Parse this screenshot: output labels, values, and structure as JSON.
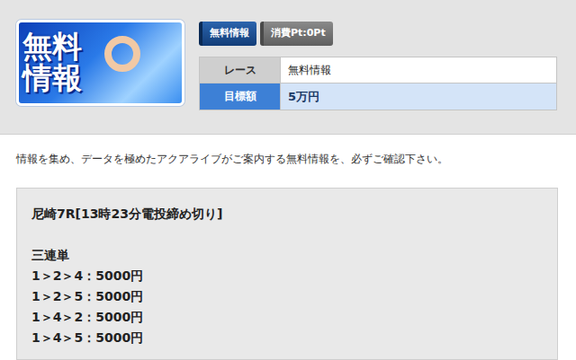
{
  "banner": {
    "text": "無料情報"
  },
  "tags": [
    {
      "label": "無料情報",
      "kind": "primary"
    },
    {
      "label": "消費Pt:0Pt",
      "kind": "secondary"
    }
  ],
  "info": [
    {
      "label": "レース",
      "value": "無料情報",
      "kind": "plain"
    },
    {
      "label": "目標額",
      "value": "5万円",
      "kind": "highlight"
    }
  ],
  "intro": "情報を集め、データを極めたアクアライブがご案内する無料情報を、必ずご確認下さい。",
  "pick": {
    "race": "尼崎7R[13時23分電投締め切り]",
    "bet_type": "三連単",
    "lines": [
      "1＞2＞4：5000円",
      "1＞2＞5：5000円",
      "1＞4＞2：5000円",
      "1＞4＞5：5000円"
    ]
  }
}
